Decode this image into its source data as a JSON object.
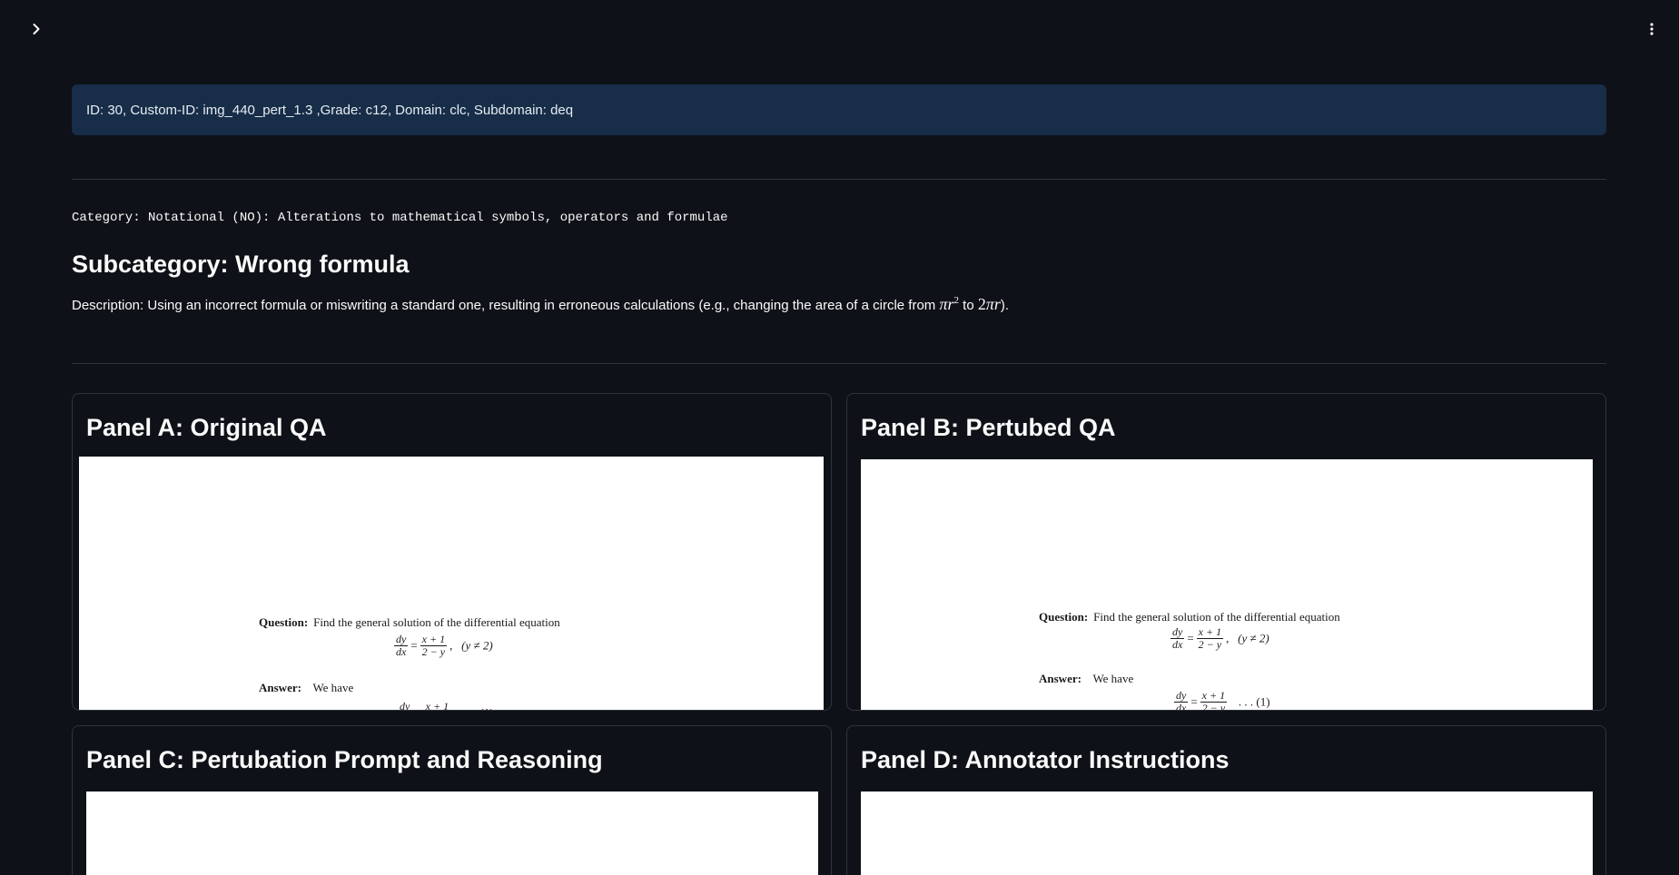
{
  "info": {
    "text": "ID: 30, Custom-ID: img_440_pert_1.3 ,Grade: c12, Domain: clc, Subdomain: deq"
  },
  "category": {
    "text": "Category: Notational (NO): Alterations to mathematical symbols, operators and formulae"
  },
  "subcategory": {
    "text": "Subcategory: Wrong formula"
  },
  "description": {
    "prefix": "Description: Using an incorrect formula or miswriting a standard one, resulting in erroneous calculations (e.g., changing the area of a circle from ",
    "math1_base": "πr",
    "math1_exp": "2",
    "middle": " to ",
    "math2_num": "2",
    "math2_rest": "πr",
    "suffix": ")."
  },
  "panels": {
    "a": {
      "title": "Panel A: Original QA"
    },
    "b": {
      "title": "Panel B: Pertubed QA"
    },
    "c": {
      "title": "Panel C: Pertubation Prompt and Reasoning"
    },
    "d": {
      "title": "Panel D: Annotator Instructions"
    }
  },
  "doc": {
    "question_label": "Question:",
    "question_text": "Find the general solution of the differential equation",
    "eq_dy": "dy",
    "eq_dx": "dx",
    "eq_num": "x + 1",
    "eq_den": "2 − y",
    "eq_cond": "(y ≠ 2)",
    "answer_label": "Answer:",
    "answer_text": "We have",
    "eq_ref": ". . . (1)"
  },
  "icons": {
    "sidebar_toggle": "chevron-right-icon",
    "menu": "vertical-ellipsis-icon"
  }
}
